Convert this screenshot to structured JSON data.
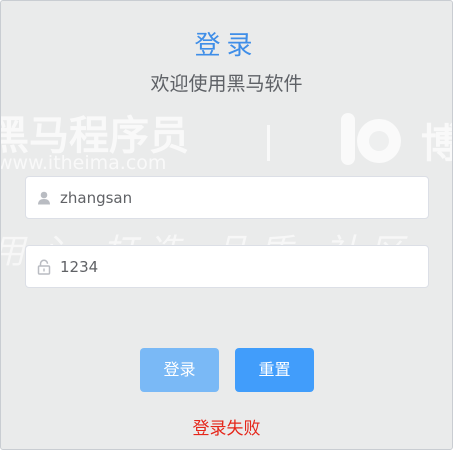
{
  "header": {
    "title": "登录",
    "subtitle": "欢迎使用黑马软件"
  },
  "watermark": {
    "brand_cn": "黑马程序员",
    "url": "www.itheima.com",
    "right_glyph": "博",
    "slogan": "用 心 · 打 造 · 品 质 · 社 区"
  },
  "form": {
    "username": {
      "value": "zhangsan",
      "icon": "user-icon"
    },
    "password": {
      "value": "1234",
      "icon": "lock-icon"
    }
  },
  "buttons": {
    "login": "登录",
    "reset": "重置"
  },
  "status": {
    "message": "登录失败",
    "color": "#e5261a"
  },
  "colors": {
    "title": "#3f8ee8",
    "login_button": "#7ab9f6",
    "reset_button": "#419dfb",
    "background": "#eaebeb"
  }
}
